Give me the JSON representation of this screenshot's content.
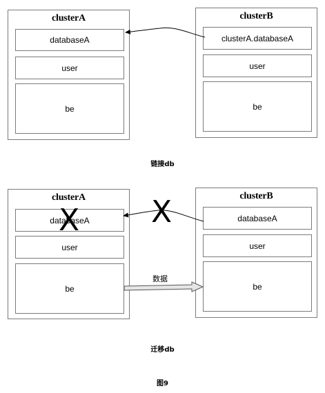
{
  "section1": {
    "cluster_a": {
      "title": "clusterA",
      "boxes": [
        "databaseA",
        "user",
        "be"
      ]
    },
    "cluster_b": {
      "title": "clusterB",
      "boxes": [
        "clusterA.databaseA",
        "user",
        "be"
      ]
    },
    "caption": "链接db"
  },
  "section2": {
    "cluster_a": {
      "title": "clusterA",
      "boxes": [
        "databaseA",
        "user",
        "be"
      ]
    },
    "cluster_b": {
      "title": "clusterB",
      "boxes": [
        "databaseA",
        "user",
        "be"
      ]
    },
    "x_mark_left": "X",
    "x_mark_right": "X",
    "data_arrow_label": "数据",
    "caption": "迁移db"
  },
  "figure_caption": "图9"
}
